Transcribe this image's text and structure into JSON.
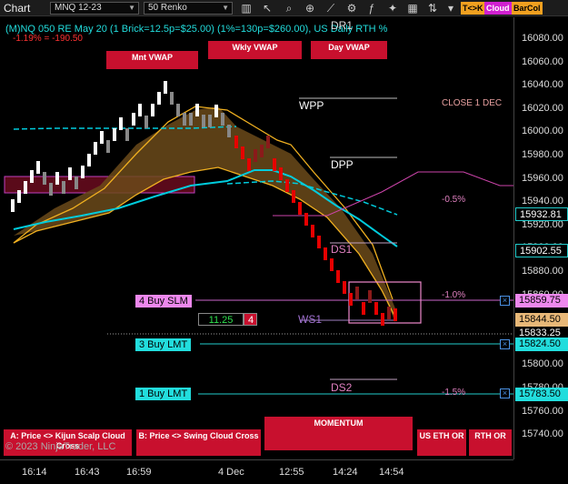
{
  "toolbar": {
    "title": "Chart",
    "instrument": "MNQ 12-23",
    "bar_type": "50 Renko",
    "badge_tk": "T<>K",
    "badge_cloud": "Cloud",
    "badge_barcol": "BarCol"
  },
  "header": {
    "line1": "(M)NQ 050 RE May 20 (1 Brick=12.5p=$25.00) (1%=130p=$260.00), US Daily RTH %",
    "line2": "-1.19% = -190.50"
  },
  "vwap_buttons": {
    "monthly": "Mnt VWAP",
    "weekly": "Wkly VWAP",
    "daily": "Day VWAP"
  },
  "levels": {
    "dr1": "DR1",
    "wpp": "WPP",
    "dpp": "DPP",
    "ds1": "DS1",
    "ws1": "WS1",
    "ds2": "DS2",
    "close_label": "CLOSE 1 DEC",
    "pct_neg_05": "-0.5%",
    "pct_neg_10": "-1.0%",
    "pct_neg_15": "-1.5%"
  },
  "orders": {
    "buy_slm": "4 Buy SLM",
    "buy_lmt_3": "3 Buy LMT",
    "buy_lmt_1": "1 Buy LMT",
    "position_price": "11.25",
    "position_qty": "4",
    "close_x": "×"
  },
  "bottom_buttons": {
    "kijun": "A: Price <> Kijun Scalp Cloud Cross",
    "swing": "B: Price <> Swing Cloud Cross",
    "momentum": "MOMENTUM",
    "us_eth": "US ETH OR",
    "rth": "RTH OR"
  },
  "copyright": "© 2023 NinjaTrader, LLC",
  "price_axis": {
    "ticks": [
      "16080.00",
      "16060.00",
      "16040.00",
      "16020.00",
      "16000.00",
      "15980.00",
      "15960.00",
      "15940.00",
      "15920.00",
      "15900.00",
      "15880.00",
      "15860.00",
      "15840.00",
      "15820.00",
      "15800.00",
      "15780.00",
      "15760.00",
      "15740.00"
    ],
    "tag_cyan_1": "15932.81",
    "tag_cyan_2": "15902.55",
    "tag_slm": "15859.75",
    "tag_position": "15844.50",
    "tag_last": "15833.25",
    "tag_lmt3": "15824.50",
    "tag_lmt1": "15783.50"
  },
  "time_axis": {
    "labels": [
      "16:14",
      "16:43",
      "16:59",
      "4 Dec",
      "12:55",
      "14:24",
      "14:54"
    ]
  },
  "colors": {
    "up_brick": "#ffffff",
    "down_brick": "#e60000",
    "cloud": "#6b4a1a",
    "cyan": "#00ccdd",
    "order_pink": "#ee88ee",
    "order_cyan": "#22dddd",
    "vwap_red": "#c8102e",
    "gold": "#f0b020"
  }
}
